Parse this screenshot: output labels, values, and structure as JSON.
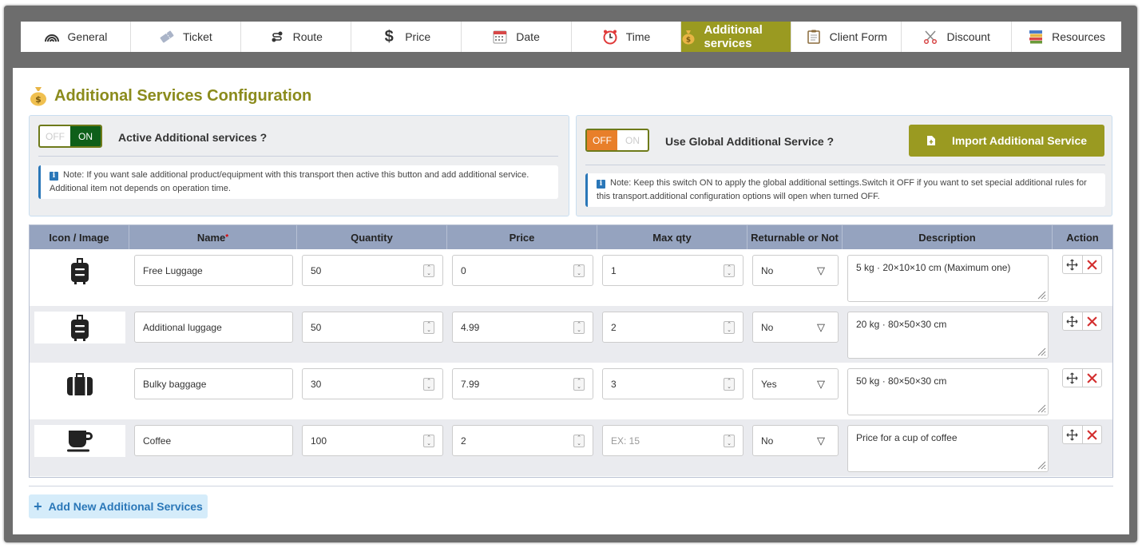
{
  "tabs": [
    {
      "label": "General",
      "icon": "wifi-arc-icon"
    },
    {
      "label": "Ticket",
      "icon": "ticket-icon"
    },
    {
      "label": "Route",
      "icon": "route-icon"
    },
    {
      "label": "Price",
      "icon": "dollar-icon"
    },
    {
      "label": "Date",
      "icon": "calendar-icon"
    },
    {
      "label": "Time",
      "icon": "alarm-clock-icon"
    },
    {
      "label": "Additional services",
      "icon": "money-bag-icon",
      "active": true
    },
    {
      "label": "Client Form",
      "icon": "clipboard-icon"
    },
    {
      "label": "Discount",
      "icon": "scissors-icon"
    },
    {
      "label": "Resources",
      "icon": "books-icon"
    }
  ],
  "title": "Additional Services Configuration",
  "active_box": {
    "toggle_off": "OFF",
    "toggle_on": "ON",
    "state": "on",
    "label": "Active Additional services ?",
    "note": "Note: If you want sale additional product/equipment with this transport then active this button and add additional service. Additional item not depends on operation time."
  },
  "global_box": {
    "toggle_off": "OFF",
    "toggle_on": "ON",
    "state": "off",
    "label": "Use Global Additional Service ?",
    "import_button": "Import Additional Service",
    "note": "Note: Keep this switch ON to apply the global additional settings.Switch it OFF if you want to set special additional rules for this transport.additional configuration options will open when turned OFF."
  },
  "table": {
    "headers": {
      "icon": "Icon / Image",
      "name": "Name",
      "required_mark": "*",
      "quantity": "Quantity",
      "price": "Price",
      "max_qty": "Max qty",
      "returnable": "Returnable or Not",
      "description": "Description",
      "action": "Action"
    },
    "rows": [
      {
        "icon": "suitcase-rolling-icon",
        "name": "Free Luggage",
        "quantity": "50",
        "price": "0",
        "max_qty": "1",
        "max_qty_placeholder": "",
        "returnable": "No",
        "description": "5 kg · 20×10×10 cm (Maximum one)"
      },
      {
        "icon": "suitcase-rolling-icon",
        "name": "Additional luggage",
        "quantity": "50",
        "price": "4.99",
        "max_qty": "2",
        "max_qty_placeholder": "",
        "returnable": "No",
        "description": "20 kg · 80×50×30 cm"
      },
      {
        "icon": "suitcase-icon",
        "name": "Bulky baggage",
        "quantity": "30",
        "price": "7.99",
        "max_qty": "3",
        "max_qty_placeholder": "",
        "returnable": "Yes",
        "description": "50 kg · 80×50×30 cm"
      },
      {
        "icon": "coffee-mug-icon",
        "name": "Coffee",
        "quantity": "100",
        "price": "2",
        "max_qty": "",
        "max_qty_placeholder": "EX: 15",
        "returnable": "No",
        "description": "Price for a cup of coffee"
      }
    ]
  },
  "add_button": "Add New Additional Services",
  "colors": {
    "accent": "#9a9a21",
    "toggle_on": "#0e5f19",
    "toggle_off": "#e87f2a",
    "info_blue": "#2a77b8",
    "delete_red": "#d32f2f",
    "table_header": "#95a3bf"
  }
}
